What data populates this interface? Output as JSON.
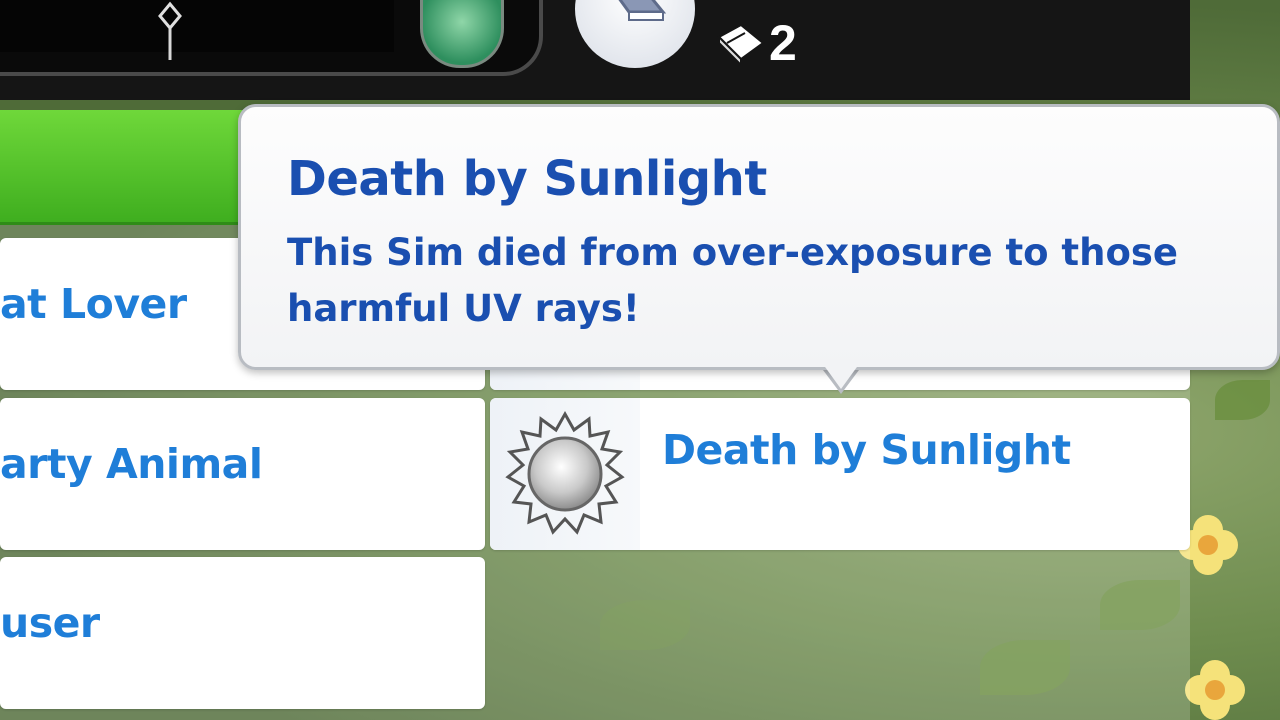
{
  "hud": {
    "book_count": "2",
    "icons": [
      "diamond-marker-icon",
      "plumbob-icon",
      "book-icon",
      "small-book-icon"
    ]
  },
  "traits": {
    "left": [
      {
        "label": "at Lover"
      },
      {
        "label": "arty Animal"
      },
      {
        "label": "user"
      }
    ],
    "right": [
      {
        "label": "Death by Sunlight",
        "icon": "sun-icon"
      }
    ]
  },
  "tooltip": {
    "title": "Death by Sunlight",
    "description": "This Sim died from over-exposure to those harmful UV rays!"
  },
  "colors": {
    "label_blue": "#1f7ed8",
    "tooltip_text": "#1a4fb0",
    "green_bar": "#4fc22a",
    "hud_black": "#151515"
  }
}
